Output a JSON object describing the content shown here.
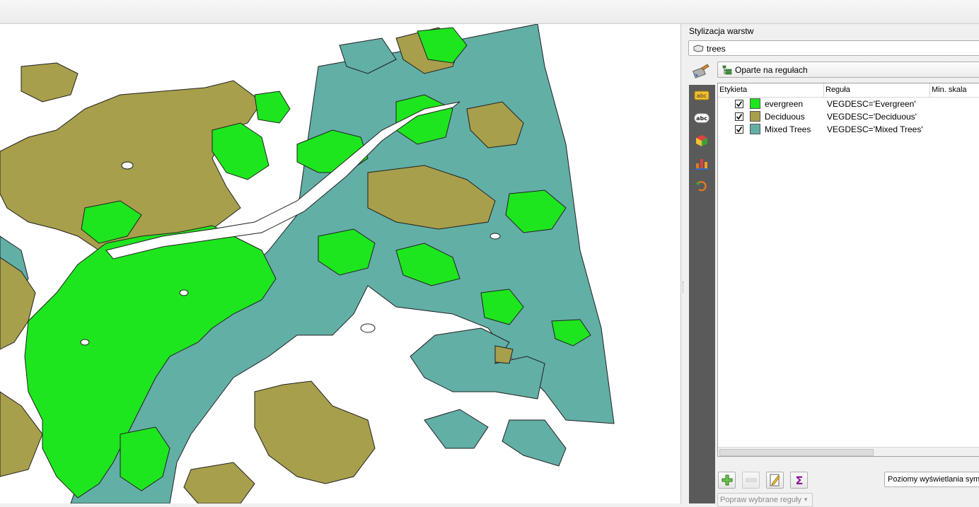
{
  "panel": {
    "title": "Stylizacja warstw",
    "layer_name": "trees",
    "renderer": "Oparte na regułach"
  },
  "table": {
    "columns": [
      "Etykieta",
      "Reguła",
      "Min. skala"
    ],
    "rows": [
      {
        "label": "evergreen",
        "rule": "VEGDESC='Evergreen'",
        "color": "#1ee61e",
        "checked": true
      },
      {
        "label": "Deciduous",
        "rule": "VEGDESC='Deciduous'",
        "color": "#a89f4c",
        "checked": true
      },
      {
        "label": "Mixed Trees",
        "rule": "VEGDESC='Mixed Trees'",
        "color": "#62afa6",
        "checked": true
      }
    ]
  },
  "buttons": {
    "levels": "Poziomy wyświetlania symboli",
    "refine": "Popraw wybrane reguły"
  },
  "map": {
    "colors": {
      "evergreen": "#1ee61e",
      "deciduous": "#a89f4c",
      "mixed": "#62afa6",
      "outline": "#1f1f1f"
    }
  },
  "icons": {
    "layer": "polygon-layer-icon",
    "brush": "paintbrush-icon",
    "renderer": "rule-based-renderer-icon",
    "toolbar": [
      "labels-icon",
      "label-abc-icon",
      "3d-view-icon",
      "diagrams-icon",
      "history-icon"
    ],
    "add": "plus-icon",
    "remove": "minus-icon",
    "edit": "edit-icon",
    "sum": "sigma-icon"
  }
}
